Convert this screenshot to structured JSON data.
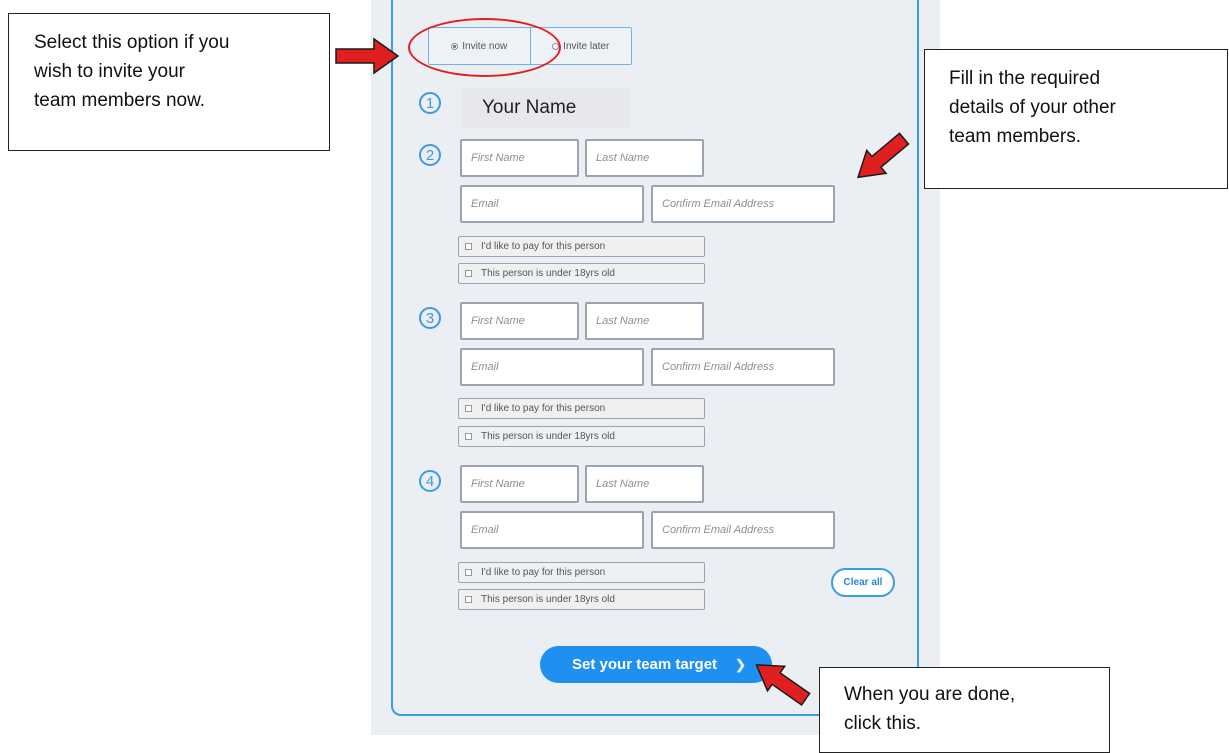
{
  "callouts": {
    "left": "Select this option if you\nwish to invite your\nteam members now.",
    "right": "Fill in the required\ndetails of your other\nteam members.",
    "bottom": "When you are done,\nclick this."
  },
  "invite": {
    "now_label": "Invite now",
    "later_label": "Invite later",
    "selected": "Invite now"
  },
  "members": {
    "self": {
      "number": "1",
      "name": "Your Name"
    },
    "others": [
      {
        "number": "2",
        "first_name_placeholder": "First Name",
        "last_name_placeholder": "Last Name",
        "email_placeholder": "Email",
        "confirm_email_placeholder": "Confirm Email Address",
        "pay_label": "I'd like to pay for this person",
        "under18_label": "This person is under 18yrs old"
      },
      {
        "number": "3",
        "first_name_placeholder": "First Name",
        "last_name_placeholder": "Last Name",
        "email_placeholder": "Email",
        "confirm_email_placeholder": "Confirm Email Address",
        "pay_label": "I'd like to pay for this person",
        "under18_label": "This person is under 18yrs old"
      },
      {
        "number": "4",
        "first_name_placeholder": "First Name",
        "last_name_placeholder": "Last Name",
        "email_placeholder": "Email",
        "confirm_email_placeholder": "Confirm Email Address",
        "pay_label": "I'd like to pay for this person",
        "under18_label": "This person is under 18yrs old"
      }
    ]
  },
  "actions": {
    "clear_all": "Clear all",
    "set_target": "Set your team target"
  },
  "colors": {
    "accent": "#1f8ff0",
    "annotation_red": "#e02020",
    "panel_bg": "#ebeef2"
  },
  "icons": {
    "chevron": "chevron-right-icon"
  }
}
